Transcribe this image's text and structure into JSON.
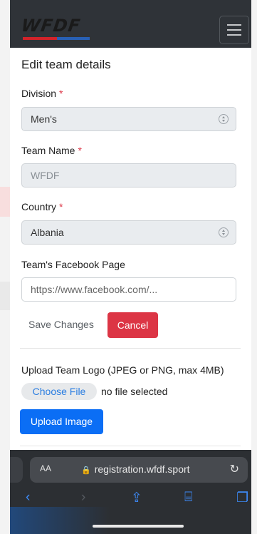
{
  "header": {
    "logo_text": "WFDF",
    "menu_icon": "hamburger-icon"
  },
  "page_title": "Edit team details",
  "form": {
    "division": {
      "label": "Division",
      "required_mark": "*",
      "value": "Men's"
    },
    "team_name": {
      "label": "Team Name",
      "required_mark": "*",
      "value": "WFDF"
    },
    "country": {
      "label": "Country",
      "required_mark": "*",
      "value": "Albania"
    },
    "facebook": {
      "label": "Team's Facebook Page",
      "placeholder": "https://www.facebook.com/..."
    },
    "save_label": "Save Changes",
    "cancel_label": "Cancel"
  },
  "upload": {
    "label": "Upload Team Logo (JPEG or PNG, max 4MB)",
    "choose_label": "Choose File",
    "no_file": "no selected",
    "no_file_text": "no file selected",
    "upload_label": "Upload Image"
  },
  "browser": {
    "text_size": "AA",
    "url": "registration.wfdf.sport"
  },
  "colors": {
    "header": "#2f3338",
    "cancel": "#dc3545",
    "upload": "#0b6ef5",
    "required": "#dc3545"
  }
}
